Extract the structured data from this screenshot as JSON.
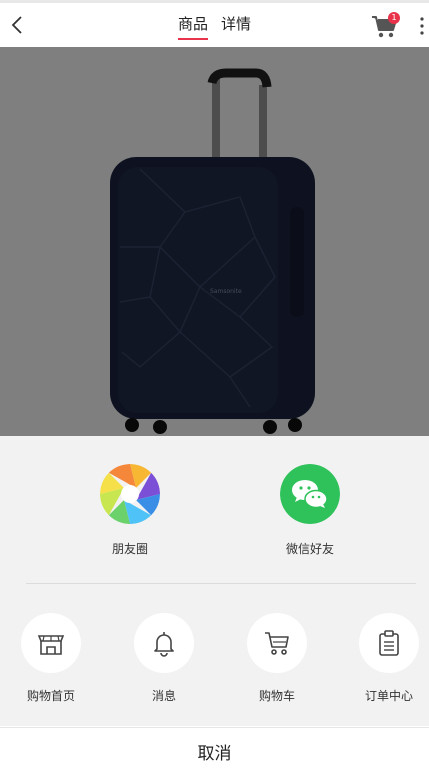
{
  "header": {
    "tabs": [
      {
        "label": "商品",
        "active": true
      },
      {
        "label": "详情",
        "active": false
      }
    ],
    "cart_badge": "1",
    "accent_color": "#e8334a",
    "icons": [
      "back-arrow-icon",
      "cart-icon",
      "more-vertical-icon"
    ]
  },
  "product": {
    "image": "suitcase",
    "logo_text": "Samsonite"
  },
  "share": {
    "items": [
      {
        "label": "朋友圈",
        "icon": "moments-icon"
      },
      {
        "label": "微信好友",
        "icon": "wechat-icon"
      }
    ]
  },
  "nav": {
    "items": [
      {
        "label": "购物首页",
        "icon": "store-icon"
      },
      {
        "label": "消息",
        "icon": "bell-icon"
      },
      {
        "label": "购物车",
        "icon": "cart-icon"
      },
      {
        "label": "订单中心",
        "icon": "clipboard-icon"
      }
    ]
  },
  "cancel_label": "取消"
}
